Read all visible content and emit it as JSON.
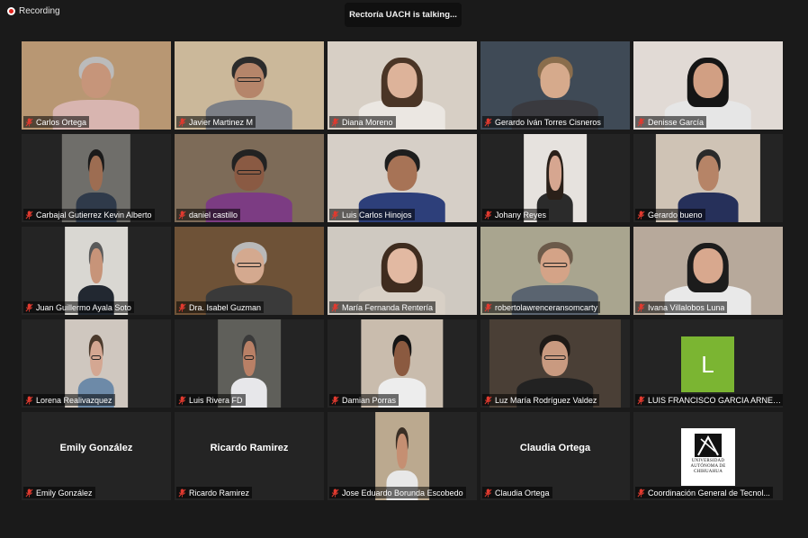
{
  "recording": {
    "label": "Recording"
  },
  "speaker": {
    "text": "Rectoría UACH is talking..."
  },
  "tiles": [
    {
      "name": "Carlos Ortega",
      "kind": "video",
      "bg": "#b89773",
      "shirt": "#d8b5b0",
      "skin": "#c6957a",
      "hair": "#bbbbbb"
    },
    {
      "name": "Javier Martinez M",
      "kind": "video",
      "bg": "#cbb89a",
      "shirt": "#7c7f86",
      "skin": "#b5856a",
      "hair": "#2b2b2b",
      "glasses": true
    },
    {
      "name": "Diana Moreno",
      "kind": "video",
      "bg": "#d7cfc5",
      "shirt": "#ebe7e2",
      "skin": "#ddb39a",
      "hair": "#4a3526",
      "long": true
    },
    {
      "name": "Gerardo Iván Torres Cisneros",
      "kind": "video",
      "bg": "#3f4a56",
      "shirt": "#3a3a3f",
      "skin": "#d6aa8c",
      "hair": "#8a6d4c"
    },
    {
      "name": "Denisse García",
      "kind": "video",
      "bg": "#e1dad5",
      "shirt": "#e6e6e6",
      "skin": "#d19f83",
      "hair": "#151515",
      "long": true
    },
    {
      "name": "Carbajal Gutierrez Kevin Alberto",
      "kind": "video",
      "bg": "#6f6e6a",
      "shirt": "#2f3a4a",
      "skin": "#9d6d52",
      "hair": "#1a1a1a"
    },
    {
      "name": "daniel castillo",
      "kind": "video",
      "bg": "#7d6b58",
      "shirt": "#7c3c83",
      "skin": "#8a5a43",
      "hair": "#222222",
      "glasses": true
    },
    {
      "name": "Luis Carlos Hinojos",
      "kind": "video",
      "bg": "#d6cfc7",
      "shirt": "#2d3f7a",
      "skin": "#a77356",
      "hair": "#1e1e1e"
    },
    {
      "name": "Johany Reyes",
      "kind": "video",
      "bg": "#e6e2de",
      "shirt": "#2b2b2b",
      "skin": "#d6a690",
      "hair": "#2a2019",
      "long": true
    },
    {
      "name": "Gerardo bueno",
      "kind": "video",
      "bg": "#cfc3b5",
      "shirt": "#26305a",
      "skin": "#b68467",
      "hair": "#2a2a2a"
    },
    {
      "name": "Juan Guillermo Ayala Soto",
      "kind": "video",
      "bg": "#d9d7d2",
      "shirt": "#222831",
      "skin": "#c79479",
      "hair": "#5a5a5a"
    },
    {
      "name": "Dra. Isabel Guzman",
      "kind": "video",
      "bg": "#6e5237",
      "shirt": "#3a3a3a",
      "skin": "#d4a98f",
      "hair": "#b9b9b9",
      "glasses": true
    },
    {
      "name": "María Fernanda Rentería",
      "kind": "video",
      "bg": "#cfc9c1",
      "shirt": "#d8d0c6",
      "skin": "#e2b9a2",
      "hair": "#3f2c1f",
      "long": true
    },
    {
      "name": "robertolawrenceransomcarty",
      "kind": "video",
      "bg": "#a9a58f",
      "shirt": "#5a6470",
      "skin": "#d4a387",
      "hair": "#6b5a4a",
      "glasses": true
    },
    {
      "name": "Ivana Villalobos Luna",
      "kind": "video",
      "bg": "#b7a99b",
      "shirt": "#e9e9e9",
      "skin": "#d8a88e",
      "hair": "#1c1c1c",
      "long": true
    },
    {
      "name": "Lorena Realivazquez",
      "kind": "video",
      "bg": "#cfc7bf",
      "shirt": "#6d8aa8",
      "skin": "#d4a792",
      "hair": "#4b3a2c",
      "glasses": true
    },
    {
      "name": "Luis Rivera FD",
      "kind": "video",
      "bg": "#5f5f5a",
      "shirt": "#e7e7ea",
      "skin": "#b98066",
      "hair": "#3a3a3a",
      "glasses": true
    },
    {
      "name": "Damian Porras",
      "kind": "video",
      "bg": "#c9bcad",
      "shirt": "#ededed",
      "skin": "#8b5a40",
      "hair": "#141414"
    },
    {
      "name": "Luz María Rodríguez Valdez",
      "kind": "video",
      "bg": "#4a3f36",
      "shirt": "#222222",
      "skin": "#c99a80",
      "hair": "#1f1a17",
      "glasses": true
    },
    {
      "name": "LUIS FRANCISCO GARCIA ARNER...",
      "kind": "initial",
      "initial": "L"
    },
    {
      "name": "Emily González",
      "kind": "text",
      "display": "Emily González"
    },
    {
      "name": "Ricardo Ramirez",
      "kind": "text",
      "display": "Ricardo Ramirez"
    },
    {
      "name": "Jose Eduardo Borunda Escobedo",
      "kind": "video",
      "bg": "#bba98f",
      "shirt": "#e8e8e8",
      "skin": "#c58f72",
      "hair": "#3a2f25"
    },
    {
      "name": "Claudia Ortega",
      "kind": "text",
      "display": "Claudia Ortega"
    },
    {
      "name": "Coordinación General de Tecnol...",
      "kind": "logo",
      "logo_text": "UNIVERSIDAD AUTÓNOMA DE CHIHUAHUA",
      "logo_short": "CHIHUAHUA"
    }
  ]
}
